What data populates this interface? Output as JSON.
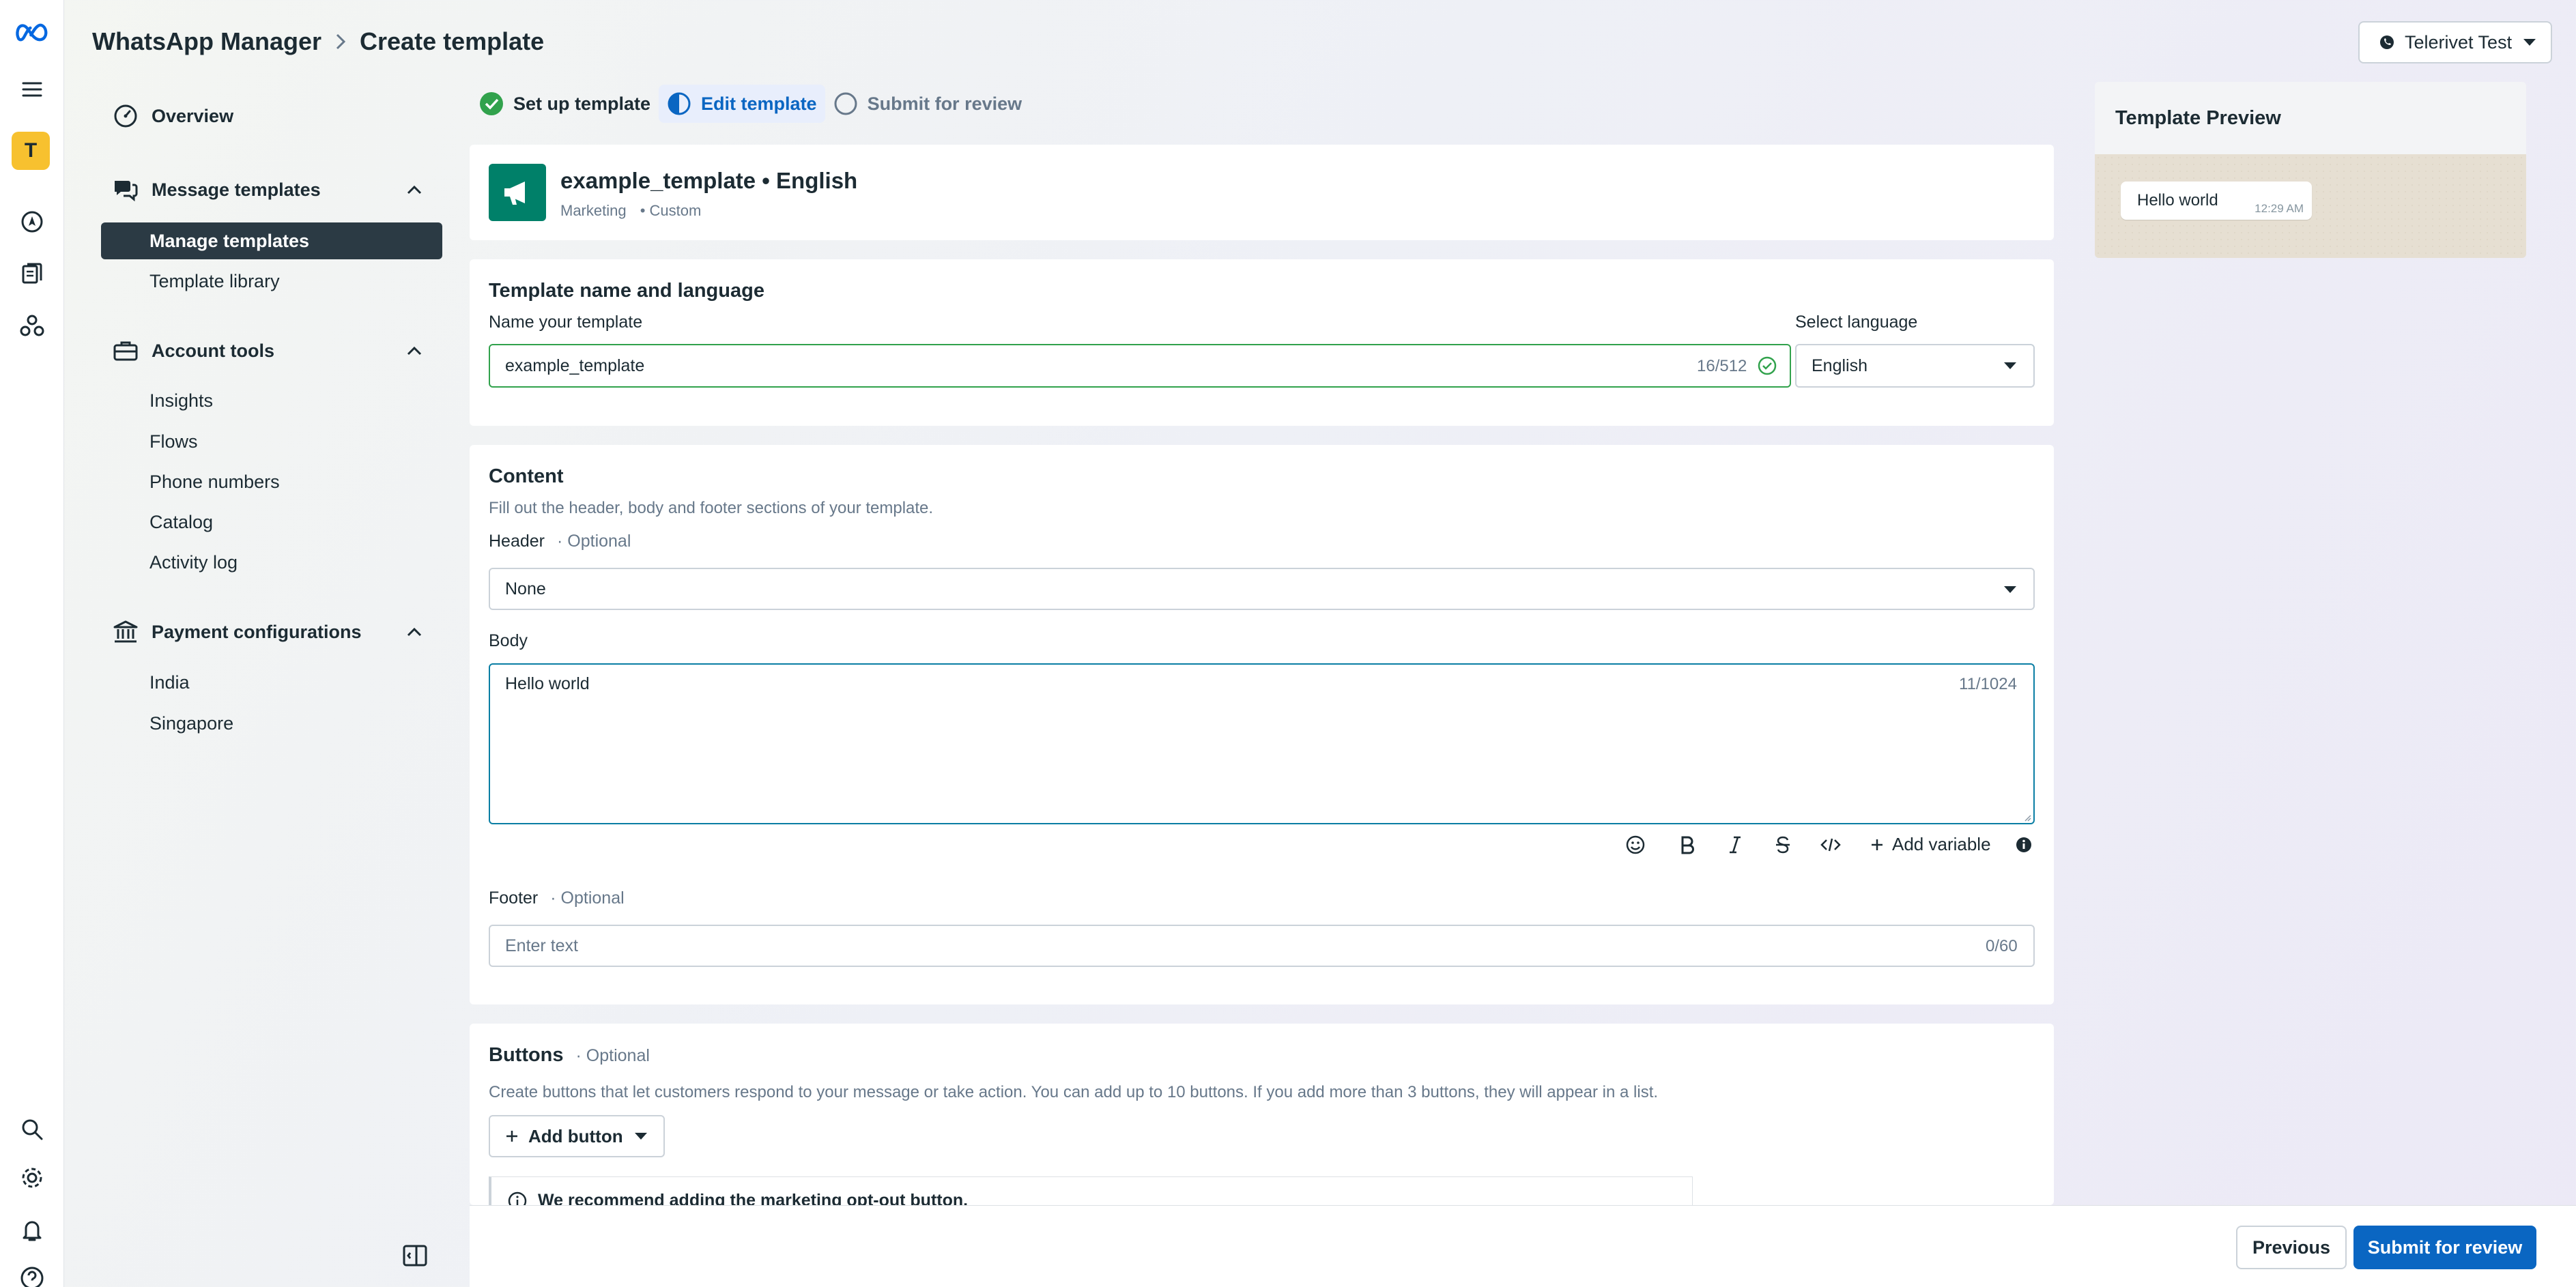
{
  "header": {
    "app_name": "WhatsApp Manager",
    "page_title": "Create template",
    "account_name": "Telerivet Test"
  },
  "rail": {
    "account_initial": "T"
  },
  "sidebar": {
    "overview": "Overview",
    "message_templates": "Message templates",
    "manage_templates": "Manage templates",
    "template_library": "Template library",
    "account_tools": "Account tools",
    "insights": "Insights",
    "flows": "Flows",
    "phone_numbers": "Phone numbers",
    "catalog": "Catalog",
    "activity_log": "Activity log",
    "payment_configurations": "Payment configurations",
    "india": "India",
    "singapore": "Singapore"
  },
  "steps": {
    "setup": "Set up template",
    "edit": "Edit template",
    "submit": "Submit for review"
  },
  "template": {
    "title": "example_template • English",
    "category": "Marketing",
    "type": "• Custom"
  },
  "name_section": {
    "title": "Template name and language",
    "name_label": "Name your template",
    "name_value": "example_template",
    "name_counter": "16/512",
    "language_label": "Select language",
    "language_value": "English"
  },
  "content": {
    "title": "Content",
    "description": "Fill out the header, body and footer sections of your template.",
    "header_label": "Header",
    "optional": "· Optional",
    "header_value": "None",
    "body_label": "Body",
    "body_value": "Hello world",
    "body_counter": "11/1024",
    "add_variable": "Add variable",
    "footer_label": "Footer",
    "footer_placeholder": "Enter text",
    "footer_counter": "0/60"
  },
  "buttons_section": {
    "title": "Buttons",
    "optional": "· Optional",
    "description": "Create buttons that let customers respond to your message or take action. You can add up to 10 buttons. If you add more than 3 buttons, they will appear in a list.",
    "add_button": "Add button",
    "recommend_text": "We recommend adding the marketing opt-out button."
  },
  "preview": {
    "title": "Template Preview",
    "message": "Hello world",
    "time": "12:29 AM"
  },
  "footer": {
    "previous": "Previous",
    "submit": "Submit for review"
  },
  "colors": {
    "primary": "#0a66c2",
    "success": "#31a24c",
    "dark": "#1c2b33",
    "brand_green": "#008069",
    "account_yellow": "#f7c12f"
  }
}
